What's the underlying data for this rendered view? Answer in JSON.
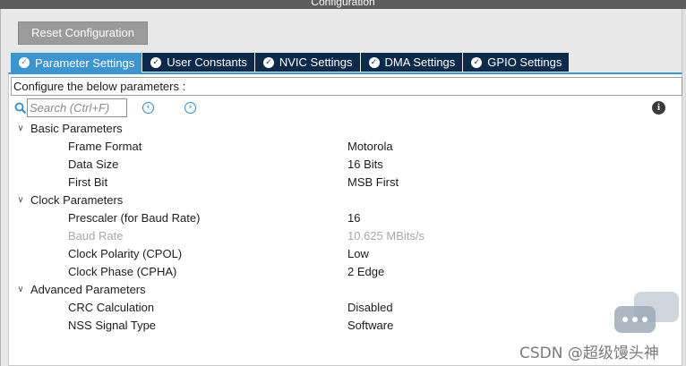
{
  "window": {
    "title": "Configuration"
  },
  "toolbar": {
    "reset_label": "Reset Configuration"
  },
  "tabs": [
    {
      "label": "Parameter Settings",
      "active": true
    },
    {
      "label": "User Constants",
      "active": false
    },
    {
      "label": "NVIC Settings",
      "active": false
    },
    {
      "label": "DMA Settings",
      "active": false
    },
    {
      "label": "GPIO Settings",
      "active": false
    }
  ],
  "configure_text": "Configure the below parameters :",
  "search": {
    "placeholder": "Search (Ctrl+F)",
    "value": ""
  },
  "groups": [
    {
      "label": "Basic Parameters",
      "params": [
        {
          "name": "Frame Format",
          "value": "Motorola"
        },
        {
          "name": "Data Size",
          "value": "16 Bits"
        },
        {
          "name": "First Bit",
          "value": "MSB First"
        }
      ]
    },
    {
      "label": "Clock Parameters",
      "params": [
        {
          "name": "Prescaler (for Baud Rate)",
          "value": "16"
        },
        {
          "name": "Baud Rate",
          "value": "10.625 MBits/s"
        },
        {
          "name": "Clock Polarity (CPOL)",
          "value": "Low"
        },
        {
          "name": "Clock Phase (CPHA)",
          "value": "2 Edge"
        }
      ]
    },
    {
      "label": "Advanced Parameters",
      "params": [
        {
          "name": "CRC Calculation",
          "value": "Disabled"
        },
        {
          "name": "NSS Signal Type",
          "value": "Software"
        }
      ]
    }
  ],
  "watermark": "CSDN @超级馒头神",
  "colors": {
    "tab_active": "#3c95cf",
    "tab_inactive": "#0d2a4a",
    "reset_button": "#9b9b9b",
    "title_bar": "#5d5d5d"
  }
}
